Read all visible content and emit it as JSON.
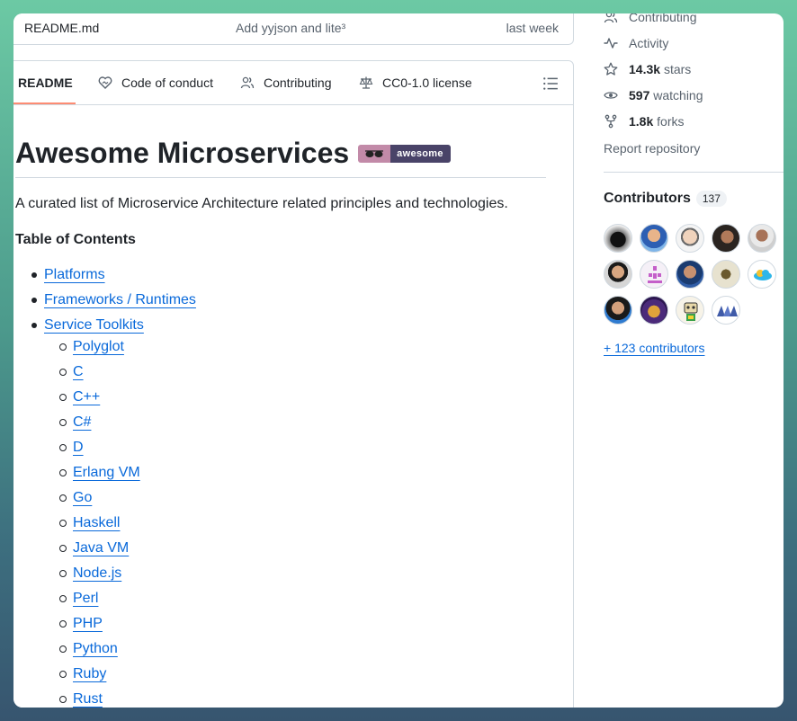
{
  "file_row": {
    "name": "README.md",
    "commit": "Add yyjson and lite³",
    "time": "last week"
  },
  "tabs": [
    {
      "label": "README",
      "icon": "book-icon"
    },
    {
      "label": "Code of conduct",
      "icon": "heart-handshake-icon"
    },
    {
      "label": "Contributing",
      "icon": "people-icon"
    },
    {
      "label": "CC0-1.0 license",
      "icon": "law-scale-icon"
    }
  ],
  "readme": {
    "title": "Awesome Microservices",
    "badge_text": "awesome",
    "intro": "A curated list of Microservice Architecture related principles and technologies.",
    "toc_title": "Table of Contents",
    "toc": [
      {
        "label": "Platforms",
        "level": 1
      },
      {
        "label": "Frameworks / Runtimes",
        "level": 1
      },
      {
        "label": "Service Toolkits",
        "level": 1
      },
      {
        "label": "Polyglot",
        "level": 2
      },
      {
        "label": "C",
        "level": 2
      },
      {
        "label": "C++",
        "level": 2
      },
      {
        "label": "C#",
        "level": 2
      },
      {
        "label": "D",
        "level": 2
      },
      {
        "label": "Erlang VM",
        "level": 2
      },
      {
        "label": "Go",
        "level": 2
      },
      {
        "label": "Haskell",
        "level": 2
      },
      {
        "label": "Java VM",
        "level": 2
      },
      {
        "label": "Node.js",
        "level": 2
      },
      {
        "label": "Perl",
        "level": 2
      },
      {
        "label": "PHP",
        "level": 2
      },
      {
        "label": "Python",
        "level": 2
      },
      {
        "label": "Ruby",
        "level": 2
      },
      {
        "label": "Rust",
        "level": 2
      }
    ]
  },
  "sidebar": {
    "contributing_label": "Contributing",
    "activity_label": "Activity",
    "stars_count": "14.3k",
    "stars_label": "stars",
    "watching_count": "597",
    "watching_label": "watching",
    "forks_count": "1.8k",
    "forks_label": "forks",
    "report_label": "Report repository",
    "contributors_title": "Contributors",
    "contributors_count": "137",
    "more_contributors": "+ 123 contributors"
  },
  "colors": {
    "link": "#0969da",
    "muted": "#59636e",
    "tab_underline": "#fd8c73",
    "badge_left": "#c28aa8",
    "badge_right": "#494368"
  }
}
